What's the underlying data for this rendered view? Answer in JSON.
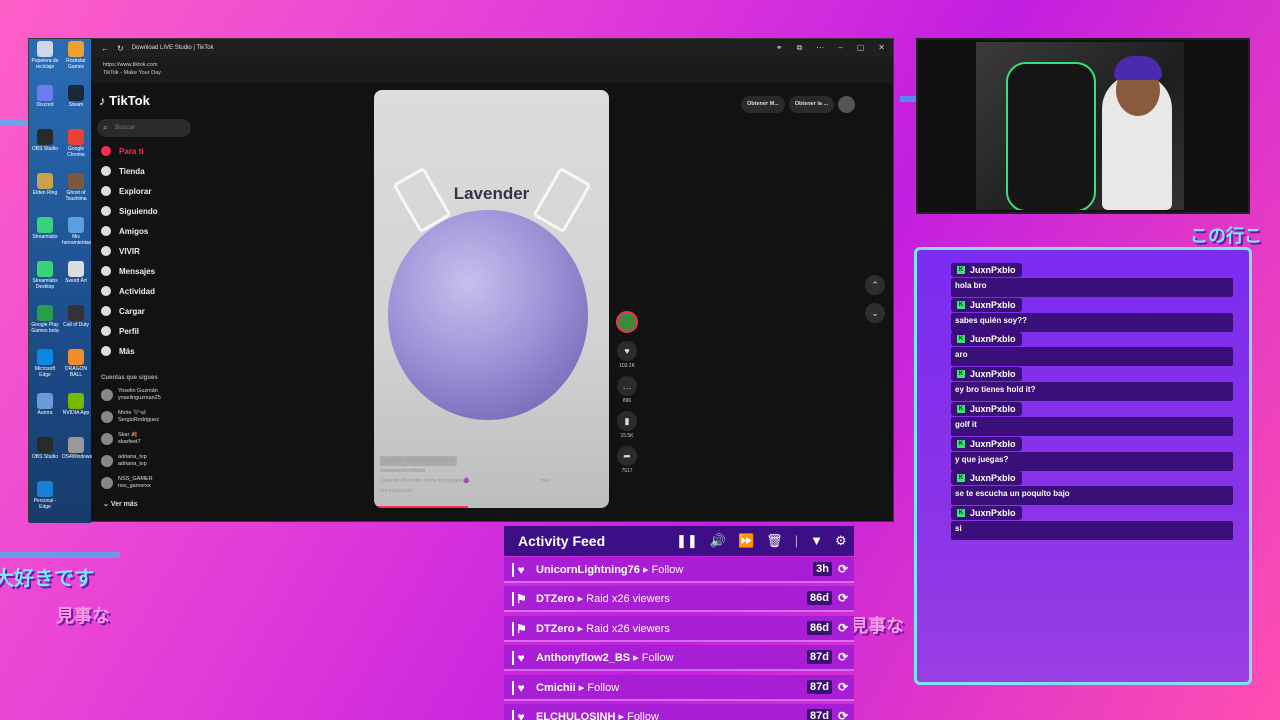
{
  "browser": {
    "title": "Download LIVE Studio | TikTok",
    "url": "https://www.tiktok.com",
    "page_title": "TikTok - Make Your Day"
  },
  "desktop": {
    "icons": [
      "Papelera de reciclaje",
      "Rockstar Games",
      "Discord",
      "Steam",
      "OBS Studio",
      "Google Chrome",
      "Elden Ring",
      "Ghost of Tsushima",
      "Streamlabs",
      "Mis herramientas",
      "Streamlabs Desktop",
      "Sword Art",
      "Google Play Games beta",
      "Call of Duty",
      "Microsoft Edge",
      "DRAGON BALL",
      "Aurora",
      "NVIDIA App",
      "OBS Studio",
      "DS4Windows",
      "Personal - Edge"
    ]
  },
  "tiktok": {
    "logo": "TikTok",
    "search_placeholder": "Buscar",
    "nav": [
      {
        "label": "Para ti",
        "active": true
      },
      {
        "label": "Tienda"
      },
      {
        "label": "Explorar"
      },
      {
        "label": "Siguiendo"
      },
      {
        "label": "Amigos"
      },
      {
        "label": "VIVIR"
      },
      {
        "label": "Mensajes"
      },
      {
        "label": "Actividad"
      },
      {
        "label": "Cargar"
      },
      {
        "label": "Perfil"
      },
      {
        "label": "Más"
      }
    ],
    "following_header": "Cuentas que sigues",
    "following": [
      {
        "name": "Yoselin Guzmán",
        "handle": "yoselinguzman25"
      },
      {
        "name": "Mvrie 🖤🦋",
        "handle": "SergioRodriguez"
      },
      {
        "name": "Skar 🍂",
        "handle": "skarfeet7"
      },
      {
        "name": "adriana_tvp",
        "handle": "adriana_tvp"
      },
      {
        "name": "NSS_GAMER",
        "handle": "nss_gamerxx"
      }
    ],
    "ver_mas": "Ver más",
    "top_buttons": [
      "Obtener M...",
      "Obtener la ..."
    ],
    "video": {
      "overlay_title": "Lavender",
      "capcut_tag": "CapCut - Una edición más fácil",
      "author": "calmplaceforkitties",
      "caption": "Creando diferentes tonos de púrpura 🟣",
      "caption_more": "más",
      "translate": "Ver traducción",
      "progress": 0.4
    },
    "actions": {
      "likes": "103.2K",
      "comments": "896",
      "saves": "15.5K",
      "shares": "7517"
    }
  },
  "chat": {
    "messages": [
      {
        "user": "JuxnPxblo",
        "text": "hola bro"
      },
      {
        "user": "JuxnPxblo",
        "text": "sabes quién soy??"
      },
      {
        "user": "JuxnPxblo",
        "text": "aro"
      },
      {
        "user": "JuxnPxblo",
        "text": "ey bro tienes hold it?"
      },
      {
        "user": "JuxnPxblo",
        "text": "golf it"
      },
      {
        "user": "JuxnPxblo",
        "text": "y que juegas?"
      },
      {
        "user": "JuxnPxblo",
        "text": "se te escucha un poquito bajo"
      },
      {
        "user": "JuxnPxblo",
        "text": "si"
      }
    ]
  },
  "feed": {
    "title": "Activity Feed",
    "items": [
      {
        "icon": "heart-icon",
        "name": "UnicornLightning76",
        "event": "Follow",
        "time": "3h"
      },
      {
        "icon": "raid-icon",
        "name": "DTZero",
        "event": "Raid x26 viewers",
        "time": "86d"
      },
      {
        "icon": "raid-icon",
        "name": "DTZero",
        "event": "Raid x26 viewers",
        "time": "86d"
      },
      {
        "icon": "heart-icon",
        "name": "Anthonyflow2_BS",
        "event": "Follow",
        "time": "87d"
      },
      {
        "icon": "heart-icon",
        "name": "Cmichii",
        "event": "Follow",
        "time": "87d"
      },
      {
        "icon": "heart-icon",
        "name": "ELCHULOSINH",
        "event": "Follow",
        "time": "87d"
      }
    ]
  },
  "overlay_text": {
    "jp1": "大好きです",
    "jp2": "見事な",
    "jp3": "見事な",
    "jp4": "この行こ"
  },
  "colors": {
    "tiktok_accent": "#fe2c55",
    "chat_bg": "#7b2cf0",
    "chat_border": "#7de3ff",
    "feed_row": "#a81ed4",
    "feed_header": "#3c0f86"
  }
}
